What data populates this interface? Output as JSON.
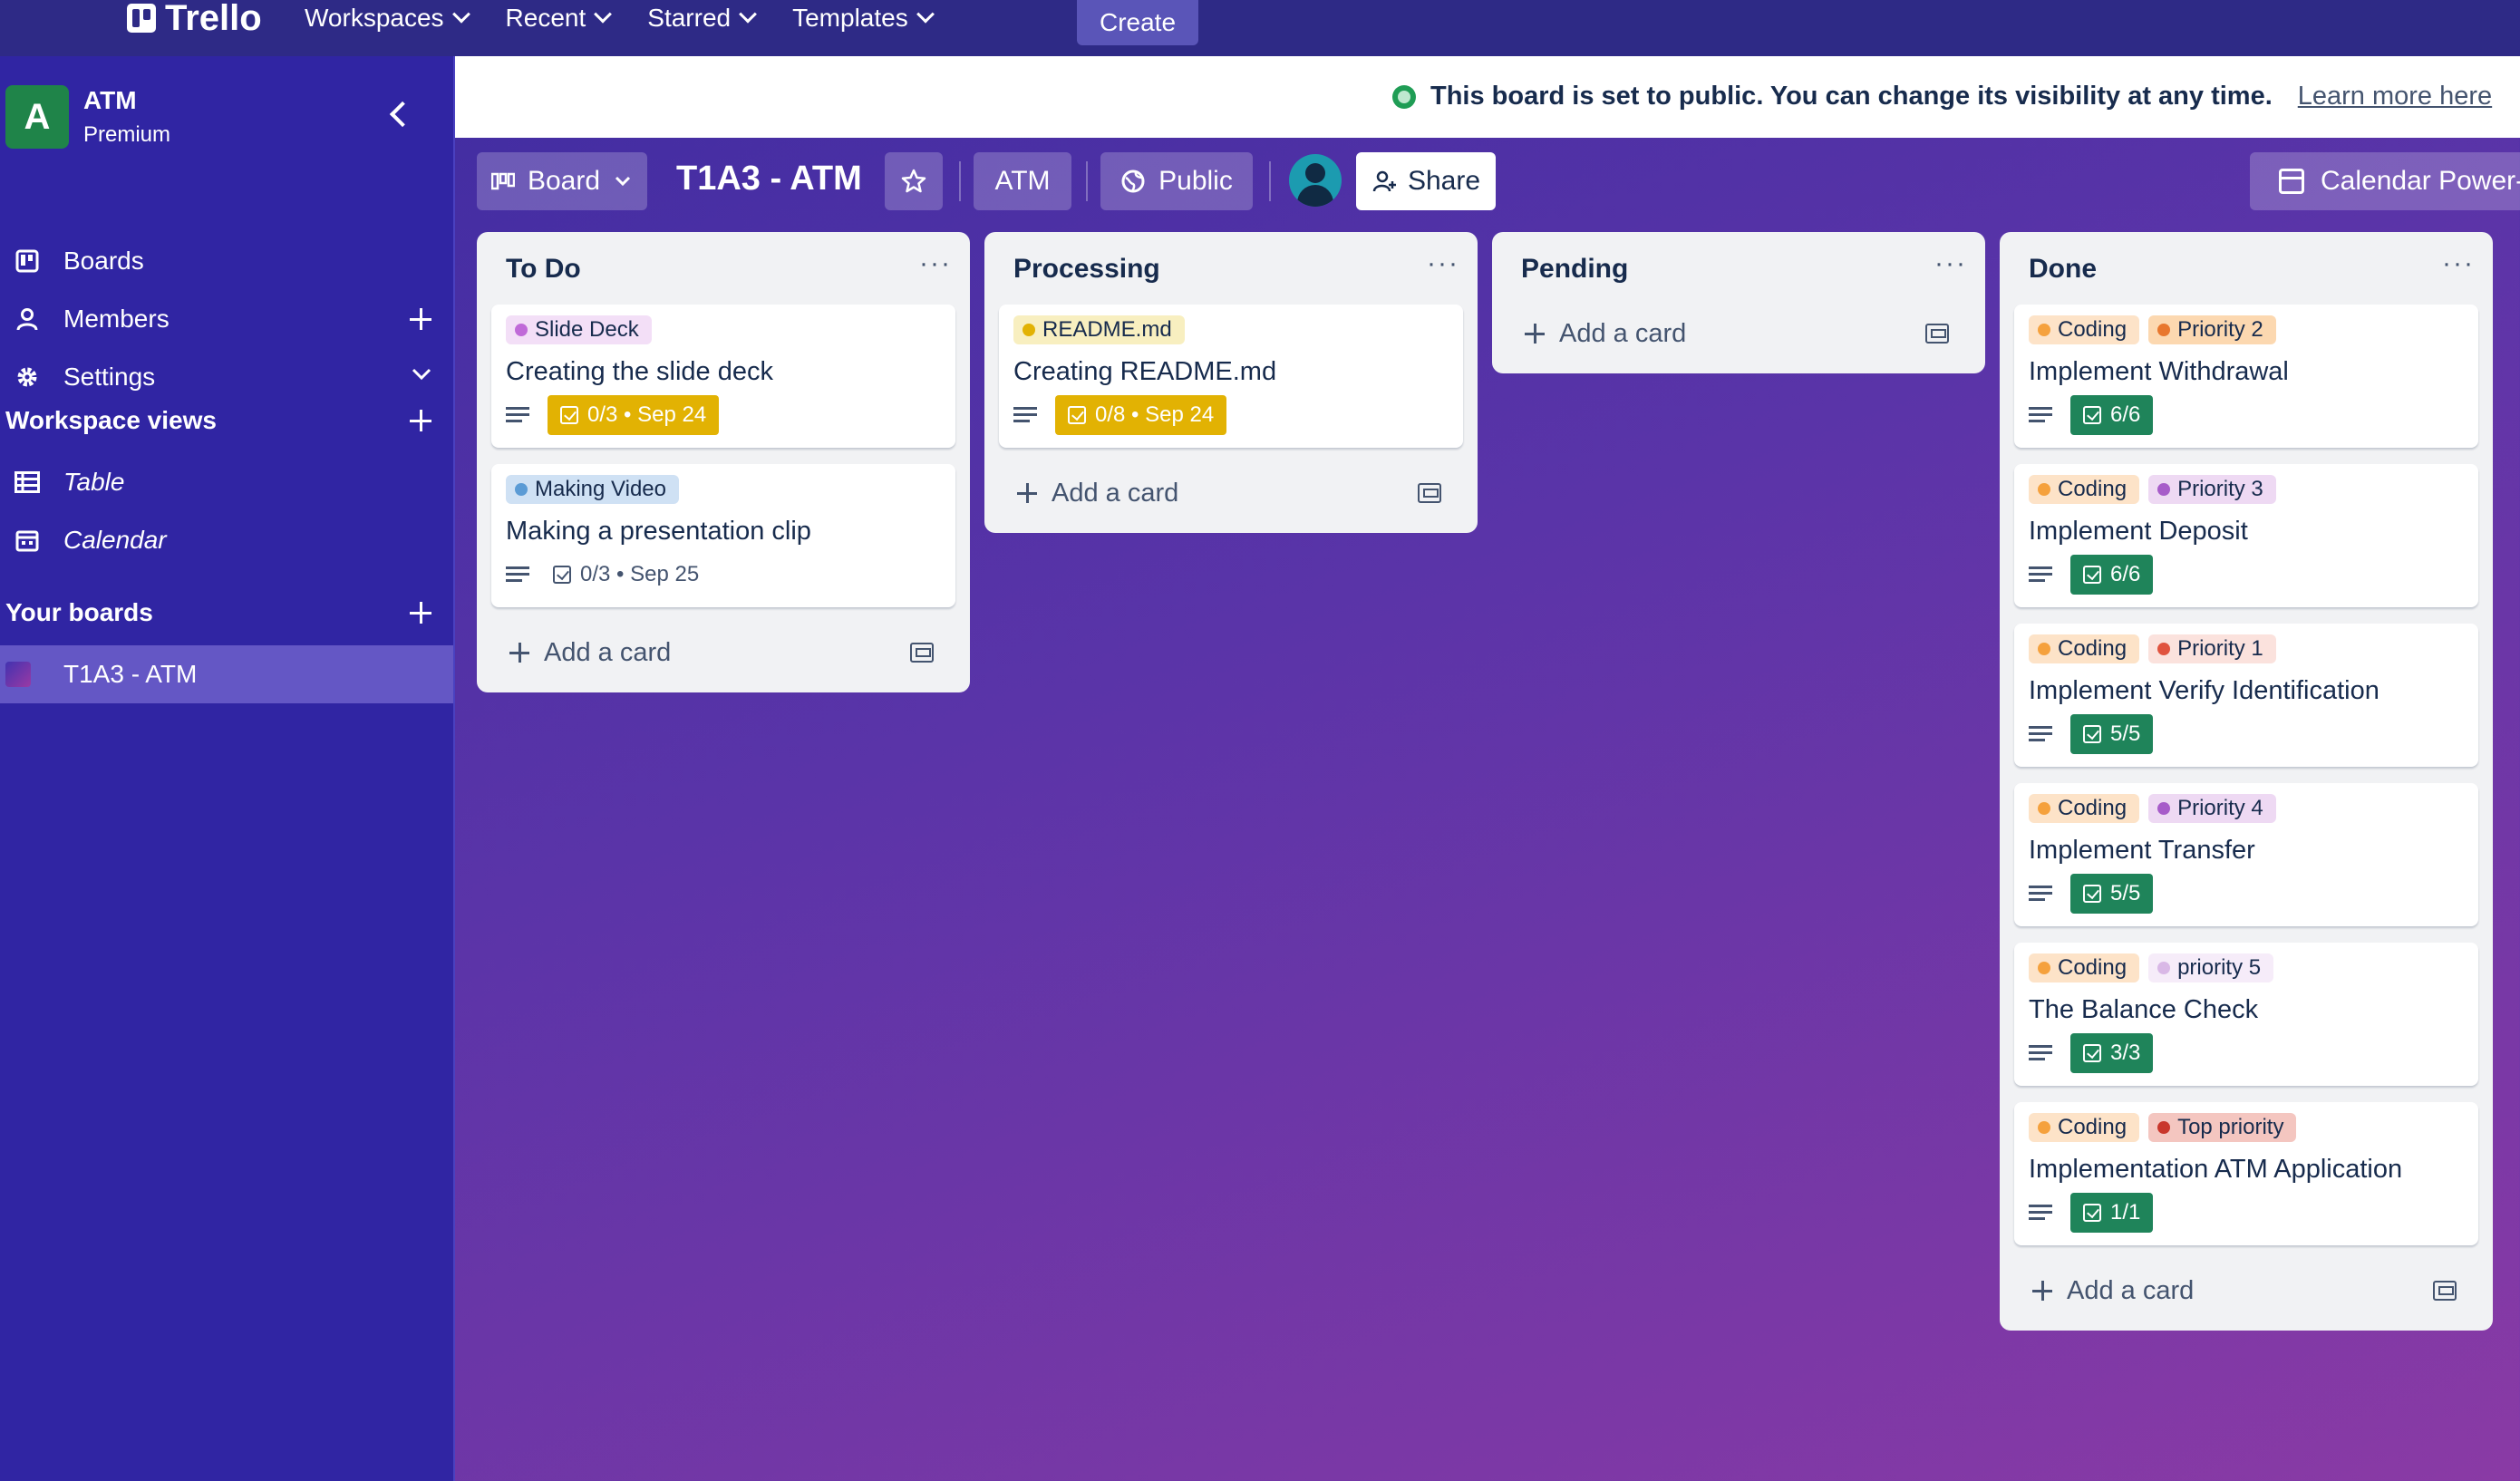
{
  "topnav": {
    "logo": "Trello",
    "menu": [
      {
        "label": "Workspaces"
      },
      {
        "label": "Recent"
      },
      {
        "label": "Starred"
      },
      {
        "label": "Templates"
      }
    ],
    "create_label": "Create"
  },
  "sidebar": {
    "workspace_initial": "A",
    "workspace_name": "ATM",
    "workspace_plan": "Premium",
    "items": [
      {
        "label": "Boards",
        "icon": "board-icon"
      },
      {
        "label": "Members",
        "icon": "person-icon"
      },
      {
        "label": "Settings",
        "icon": "gear-icon"
      }
    ],
    "views_heading": "Workspace views",
    "views": [
      {
        "label": "Table",
        "icon": "table-icon"
      },
      {
        "label": "Calendar",
        "icon": "calendar-icon"
      }
    ],
    "boards_heading": "Your boards",
    "boards": [
      {
        "label": "T1A3 - ATM"
      }
    ]
  },
  "banner": {
    "message": "This board is set to public. You can change its visibility at any time.",
    "link": "Learn more here"
  },
  "board_header": {
    "view_label": "Board",
    "title": "T1A3 - ATM",
    "workspace_label": "ATM",
    "visibility_label": "Public",
    "share_label": "Share",
    "calendar_label": "Calendar Power-Up"
  },
  "lists": [
    {
      "title": "To Do",
      "add_label": "Add a card",
      "cards": [
        {
          "labels": [
            {
              "text": "Slide Deck",
              "bg": "#f3dff7",
              "dot": "#c06ad8"
            }
          ],
          "title": "Creating the slide deck",
          "checklist": "0/3 • Sep 24",
          "badge_style": "yellow"
        },
        {
          "labels": [
            {
              "text": "Making Video",
              "bg": "#cfe1f4",
              "dot": "#5b9bd5"
            }
          ],
          "title": "Making a presentation clip",
          "checklist": "0/3 • Sep 25",
          "badge_style": "plain"
        }
      ]
    },
    {
      "title": "Processing",
      "add_label": "Add a card",
      "cards": [
        {
          "labels": [
            {
              "text": "README.md",
              "bg": "#f8efc0",
              "dot": "#e2b203"
            }
          ],
          "title": "Creating README.md",
          "checklist": "0/8 • Sep 24",
          "badge_style": "yellow"
        }
      ]
    },
    {
      "title": "Pending",
      "add_label": "Add a card",
      "cards": []
    },
    {
      "title": "Done",
      "add_label": "Add a card",
      "cards": [
        {
          "labels": [
            {
              "text": "Coding",
              "bg": "#fde3c8",
              "dot": "#f5a13d"
            },
            {
              "text": "Priority 2",
              "bg": "#fcd8b0",
              "dot": "#e8772e"
            }
          ],
          "title": "Implement Withdrawal",
          "checklist": "6/6",
          "badge_style": "green"
        },
        {
          "labels": [
            {
              "text": "Coding",
              "bg": "#fde3c8",
              "dot": "#f5a13d"
            },
            {
              "text": "Priority 3",
              "bg": "#eed9f3",
              "dot": "#a75cc9"
            }
          ],
          "title": "Implement Deposit",
          "checklist": "6/6",
          "badge_style": "green"
        },
        {
          "labels": [
            {
              "text": "Coding",
              "bg": "#fde3c8",
              "dot": "#f5a13d"
            },
            {
              "text": "Priority 1",
              "bg": "#fbe2dd",
              "dot": "#e0533f"
            }
          ],
          "title": "Implement Verify Identification",
          "checklist": "5/5",
          "badge_style": "green"
        },
        {
          "labels": [
            {
              "text": "Coding",
              "bg": "#fde3c8",
              "dot": "#f5a13d"
            },
            {
              "text": "Priority 4",
              "bg": "#eed9f3",
              "dot": "#a75cc9"
            }
          ],
          "title": "Implement Transfer",
          "checklist": "5/5",
          "badge_style": "green"
        },
        {
          "labels": [
            {
              "text": "Coding",
              "bg": "#fde3c8",
              "dot": "#f5a13d"
            },
            {
              "text": "priority 5",
              "bg": "#f6ecf9",
              "dot": "#d9b8e6"
            }
          ],
          "title": "The Balance Check",
          "checklist": "3/3",
          "badge_style": "green"
        },
        {
          "labels": [
            {
              "text": "Coding",
              "bg": "#fde3c8",
              "dot": "#f5a13d"
            },
            {
              "text": "Top priority",
              "bg": "#f4c6c0",
              "dot": "#c9372c"
            }
          ],
          "title": "Implementation ATM Application",
          "checklist": "1/1",
          "badge_style": "green"
        }
      ]
    }
  ]
}
